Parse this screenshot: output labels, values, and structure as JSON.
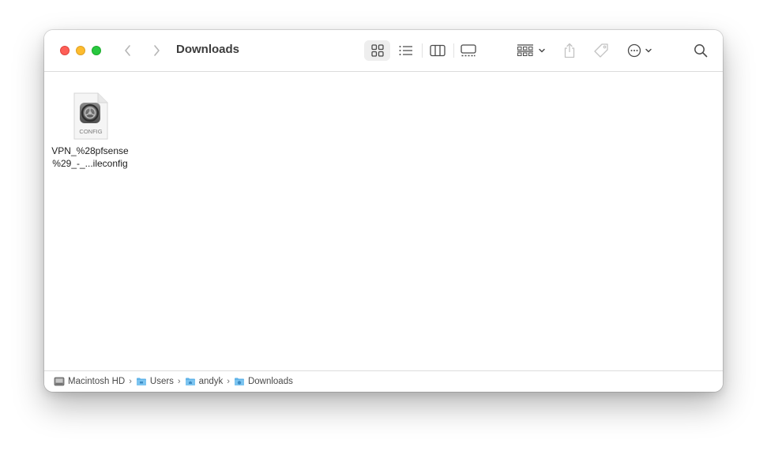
{
  "window": {
    "title": "Downloads"
  },
  "toolbar": {
    "back": "back",
    "forward": "forward",
    "view_modes": [
      "icon-view",
      "list-view",
      "column-view",
      "gallery-view"
    ],
    "active_view": "icon-view",
    "group_label": "group",
    "share_label": "share",
    "tag_label": "tags",
    "more_label": "more-actions",
    "search_label": "search"
  },
  "files": [
    {
      "name_line1": "VPN_%28pfsense",
      "name_line2": "%29_-_...ileconfig",
      "icon_label": "CONFIG",
      "type": "config-profile"
    }
  ],
  "path_bar": {
    "items": [
      {
        "label": "Macintosh HD",
        "icon": "hard-drive-icon"
      },
      {
        "label": "Users",
        "icon": "folder-icon"
      },
      {
        "label": "andyk",
        "icon": "home-folder-icon"
      },
      {
        "label": "Downloads",
        "icon": "downloads-folder-icon"
      }
    ],
    "separator": "›"
  },
  "colors": {
    "close": "#fe5f57",
    "minimize": "#febc2e",
    "zoom": "#28c840",
    "folder_blue": "#5fb3e8"
  }
}
